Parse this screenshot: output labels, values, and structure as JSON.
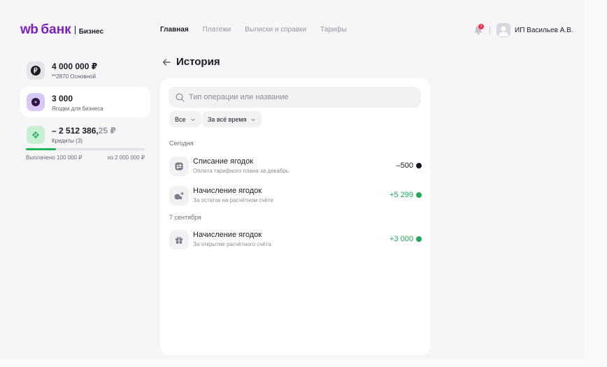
{
  "header": {
    "logo_wb": "wb",
    "logo_bank": "банк",
    "logo_business": "Бизнес",
    "nav": [
      {
        "label": "Главная",
        "active": true
      },
      {
        "label": "Платежи",
        "active": false
      },
      {
        "label": "Выписки и справки",
        "active": false
      },
      {
        "label": "Тарифы",
        "active": false
      }
    ],
    "notifications_count": "1",
    "user_name": "ИП Васильев А.В."
  },
  "sidebar": {
    "accounts": [
      {
        "title": "4 000 000 ₽",
        "subtitle": "**2870 Основной",
        "icon": "ruble-coin-icon"
      },
      {
        "title": "3 000",
        "subtitle": "Ягодки для бизнеса",
        "icon": "berry-icon"
      },
      {
        "title_main": "– 2 512 386,",
        "title_dim": "25 ₽",
        "subtitle": "Кредиты (3)",
        "icon": "credit-icon"
      }
    ],
    "credit": {
      "paid_label": "Выплачено 100 000 ₽",
      "total_label": "из 2 000 000 ₽",
      "progress_fraction": 0.25
    }
  },
  "main": {
    "title": "История",
    "search_placeholder": "Тип операции или название",
    "filters": {
      "type": "Все",
      "period": "За всё время"
    },
    "groups": [
      {
        "label": "Сегодня",
        "items": [
          {
            "title": "Списание ягодок",
            "subtitle": "Оплата тарифного плана за декабрь",
            "amount": "–500",
            "positive": false,
            "icon": "exchange-icon"
          },
          {
            "title": "Начисление ягодок",
            "subtitle": "За остаток на расчётном счёте",
            "amount": "+5 299",
            "positive": true,
            "icon": "berries-plus-icon"
          }
        ]
      },
      {
        "label": "7 сентября",
        "items": [
          {
            "title": "Начисление ягодок",
            "subtitle": "За открытие расчётного счёта",
            "amount": "+3 000",
            "positive": true,
            "icon": "gift-icon"
          }
        ]
      }
    ]
  },
  "colors": {
    "brand": "#7a1fc0",
    "positive": "#1fa855",
    "credit_bar": "#1fb45a",
    "badge": "#f0324a"
  }
}
